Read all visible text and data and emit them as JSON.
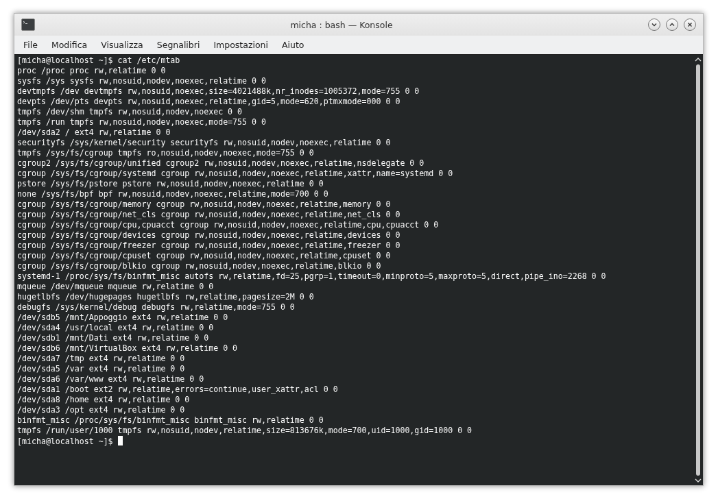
{
  "window": {
    "title": "micha : bash — Konsole"
  },
  "menu": [
    "File",
    "Modifica",
    "Visualizza",
    "Segnalibri",
    "Impostazioni",
    "Aiuto"
  ],
  "terminal": {
    "lines": [
      "[micha@localhost ~]$ cat /etc/mtab",
      "proc /proc proc rw,relatime 0 0",
      "sysfs /sys sysfs rw,nosuid,nodev,noexec,relatime 0 0",
      "devtmpfs /dev devtmpfs rw,nosuid,noexec,size=4021488k,nr_inodes=1005372,mode=755 0 0",
      "devpts /dev/pts devpts rw,nosuid,noexec,relatime,gid=5,mode=620,ptmxmode=000 0 0",
      "tmpfs /dev/shm tmpfs rw,nosuid,nodev,noexec 0 0",
      "tmpfs /run tmpfs rw,nosuid,nodev,noexec,mode=755 0 0",
      "/dev/sda2 / ext4 rw,relatime 0 0",
      "securityfs /sys/kernel/security securityfs rw,nosuid,nodev,noexec,relatime 0 0",
      "tmpfs /sys/fs/cgroup tmpfs ro,nosuid,nodev,noexec,mode=755 0 0",
      "cgroup2 /sys/fs/cgroup/unified cgroup2 rw,nosuid,nodev,noexec,relatime,nsdelegate 0 0",
      "cgroup /sys/fs/cgroup/systemd cgroup rw,nosuid,nodev,noexec,relatime,xattr,name=systemd 0 0",
      "pstore /sys/fs/pstore pstore rw,nosuid,nodev,noexec,relatime 0 0",
      "none /sys/fs/bpf bpf rw,nosuid,nodev,noexec,relatime,mode=700 0 0",
      "cgroup /sys/fs/cgroup/memory cgroup rw,nosuid,nodev,noexec,relatime,memory 0 0",
      "cgroup /sys/fs/cgroup/net_cls cgroup rw,nosuid,nodev,noexec,relatime,net_cls 0 0",
      "cgroup /sys/fs/cgroup/cpu,cpuacct cgroup rw,nosuid,nodev,noexec,relatime,cpu,cpuacct 0 0",
      "cgroup /sys/fs/cgroup/devices cgroup rw,nosuid,nodev,noexec,relatime,devices 0 0",
      "cgroup /sys/fs/cgroup/freezer cgroup rw,nosuid,nodev,noexec,relatime,freezer 0 0",
      "cgroup /sys/fs/cgroup/cpuset cgroup rw,nosuid,nodev,noexec,relatime,cpuset 0 0",
      "cgroup /sys/fs/cgroup/blkio cgroup rw,nosuid,nodev,noexec,relatime,blkio 0 0",
      "systemd-1 /proc/sys/fs/binfmt_misc autofs rw,relatime,fd=25,pgrp=1,timeout=0,minproto=5,maxproto=5,direct,pipe_ino=2268 0 0",
      "mqueue /dev/mqueue mqueue rw,relatime 0 0",
      "hugetlbfs /dev/hugepages hugetlbfs rw,relatime,pagesize=2M 0 0",
      "debugfs /sys/kernel/debug debugfs rw,relatime,mode=755 0 0",
      "/dev/sdb5 /mnt/Appoggio ext4 rw,relatime 0 0",
      "/dev/sda4 /usr/local ext4 rw,relatime 0 0",
      "/dev/sdb1 /mnt/Dati ext4 rw,relatime 0 0",
      "/dev/sdb6 /mnt/VirtualBox ext4 rw,relatime 0 0",
      "/dev/sda7 /tmp ext4 rw,relatime 0 0",
      "/dev/sda5 /var ext4 rw,relatime 0 0",
      "/dev/sda6 /var/www ext4 rw,relatime 0 0",
      "/dev/sda1 /boot ext2 rw,relatime,errors=continue,user_xattr,acl 0 0",
      "/dev/sda8 /home ext4 rw,relatime 0 0",
      "/dev/sda3 /opt ext4 rw,relatime 0 0",
      "binfmt_misc /proc/sys/fs/binfmt_misc binfmt_misc rw,relatime 0 0",
      "tmpfs /run/user/1000 tmpfs rw,nosuid,nodev,relatime,size=813676k,mode=700,uid=1000,gid=1000 0 0"
    ],
    "prompt": "[micha@localhost ~]$"
  }
}
